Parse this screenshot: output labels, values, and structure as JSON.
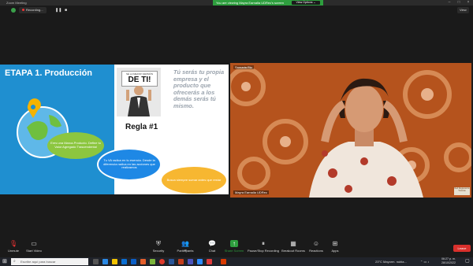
{
  "window": {
    "title": "Zoom Meeting"
  },
  "share_bar": {
    "message": "You are viewing Mayra Earnalla UDRec's screen",
    "view_options": "View Options ⌄"
  },
  "recording": {
    "label": "Recording..."
  },
  "view_button": "View",
  "slide": {
    "title": "ETAPA 1. Producción",
    "sign_small": "SÉ LA MEJOR VERSIÓN",
    "sign_big": "DE TI!",
    "regla": "Regla #1",
    "quote": "Tú serás tu propia empresa y el producto que ofrecerás a los demás serás tú mismo.",
    "bubble_green": "Eres una Marca-Producto. Define tu Valor Agregado Trascendental",
    "bubble_blue": "Tu VA radica en tu esencia. Desde la diferencia radica en las acciones que realizamos",
    "bubble_yellow": "Busca siempre sumar antes que restar"
  },
  "video": {
    "top_name": "Samaria Rtz",
    "bottom_name": "Mayra Earnalla UDRec",
    "logo": "Red Regional de Tutorías"
  },
  "toolbar": {
    "unmute": "Unmute",
    "start_video": "Start Video",
    "security": "Security",
    "participants": "Participants",
    "participants_count": "27",
    "chat": "Chat",
    "share_screen": "Share Screen",
    "pause_recording": "Pause/Stop Recording",
    "breakout": "Breakout Rooms",
    "reactions": "Reactions",
    "apps": "Apps",
    "end": "Leave"
  },
  "taskbar": {
    "search_placeholder": "Escribe aquí para buscar",
    "weather": "23°C  Mayorm. nubla...",
    "time": "06:27 p. m.",
    "date": "28/10/2022"
  },
  "colors": {
    "share_green": "#2e9e3e",
    "slide_blue": "#1f8fd0",
    "end_red": "#d9302c",
    "video_bg": "#b5531d"
  }
}
